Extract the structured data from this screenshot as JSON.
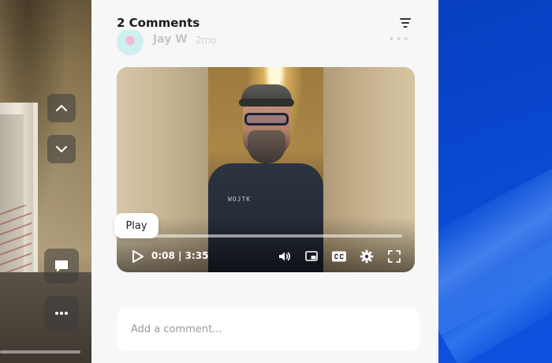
{
  "panel": {
    "title": "2 Comments"
  },
  "comment": {
    "author": "Jay W",
    "age": "2mo"
  },
  "video": {
    "tooltip": "Play",
    "time": "0:08 | 3:35",
    "progress_fraction": 0.037,
    "shirt_text": "WOJTK"
  },
  "composer": {
    "placeholder": "Add a comment..."
  },
  "icons": {
    "filter": "filter-icon",
    "up": "chevron-up-icon",
    "down": "chevron-down-icon",
    "comment": "comment-icon",
    "more": "more-icon",
    "play": "play-icon",
    "volume": "volume-icon",
    "pip": "picture-in-picture-icon",
    "cc": "closed-captions-icon",
    "settings": "gear-icon",
    "fullscreen": "fullscreen-icon"
  },
  "colors": {
    "panel_bg": "#f7f7f7",
    "desktop_blue": "#0a46c8"
  }
}
